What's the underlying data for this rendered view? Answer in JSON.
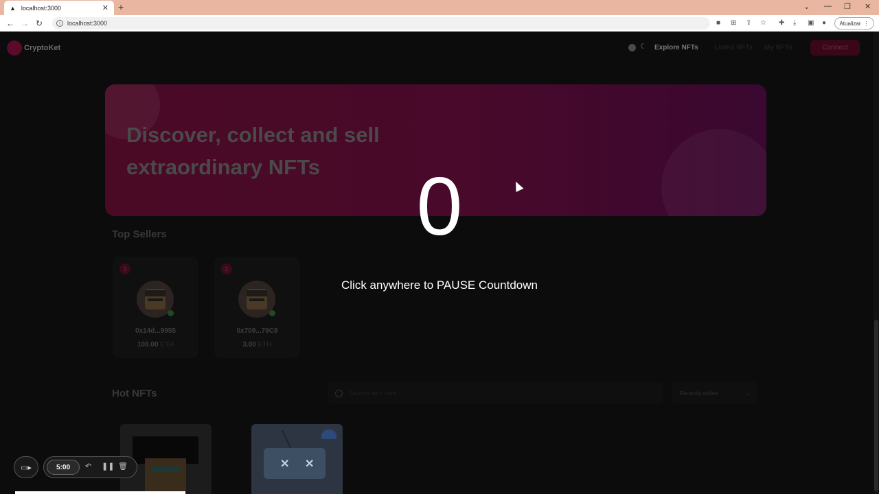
{
  "browser": {
    "tab_title": "localhost:3000",
    "tab_close": "✕",
    "new_tab": "+",
    "url": "localhost:3000",
    "update_label": "Atualizar"
  },
  "site": {
    "brand": "CryptoKet",
    "nav": {
      "explore": "Explore NFTs",
      "listed": "Listed NFTs",
      "my_nfts": "My NFTs",
      "connect": "Connect"
    },
    "hero_title": "Discover, collect and sell extraordinary NFTs",
    "top_sellers_title": "Top Sellers",
    "sellers": [
      {
        "rank": "1",
        "address": "0x14d...9955",
        "amount": "100.00",
        "unit": "ETH"
      },
      {
        "rank": "2",
        "address": "0x709...79C8",
        "amount": "3.00",
        "unit": "ETH"
      }
    ],
    "hot_nfts_title": "Hot NFTs",
    "search_placeholder": "Search item here",
    "sort_selected": "Recently added"
  },
  "overlay": {
    "countdown": "0",
    "hint": "Click anywhere to PAUSE Countdown"
  },
  "recorder": {
    "timer": "5:00"
  }
}
